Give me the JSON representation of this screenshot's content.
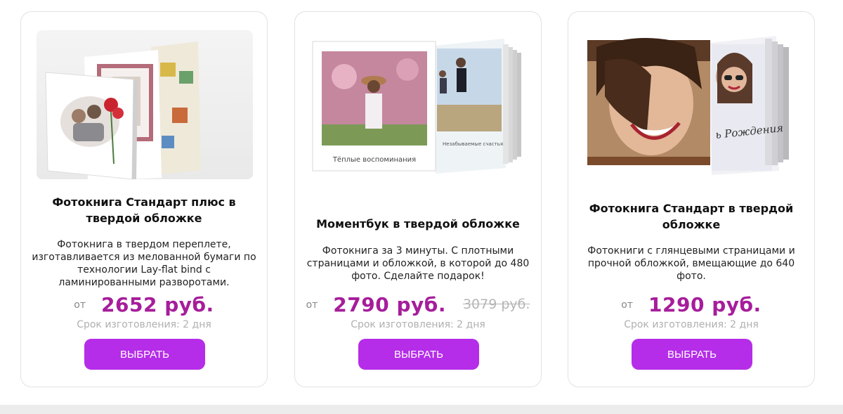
{
  "products": [
    {
      "title": "Фотокнига Стандарт плюс в твердой обложке",
      "description": "Фотокнига в твердом переплете, изготавливается из мелованной бумаги по технологии Lay-flat bind с ламинированными разворотами.",
      "price_prefix": "от",
      "price": "2652 руб.",
      "term": "Срок изготовления: 2 дня",
      "button": "ВЫБРАТЬ"
    },
    {
      "title": "Моментбук в твердой обложке",
      "description": "Фотокнига за 3 минуты. С плотными страницами и обложкой, в которой до 480 фото. Сделайте подарок!",
      "price_prefix": "от",
      "price": "2790 руб.",
      "old_price": "3079 руб.",
      "cover_caption": "Тёплые воспоминания",
      "page_caption": "Незабываемые счастья",
      "term": "Срок изготовления: 2 дня",
      "button": "ВЫБРАТЬ"
    },
    {
      "title": "Фотокнига Стандарт в твердой обложке",
      "description": "Фотокниги с глянцевыми страницами и прочной обложкой, вмещающие до 640 фото.",
      "price_prefix": "от",
      "price": "1290 руб.",
      "page_caption": "ь Рождения",
      "term": "Срок изготовления: 2 дня",
      "button": "ВЫБРАТЬ"
    }
  ],
  "colors": {
    "price": "#a61d9b",
    "button": "#b52de8",
    "muted": "#b0b0b0",
    "border": "#e2e2e2"
  }
}
